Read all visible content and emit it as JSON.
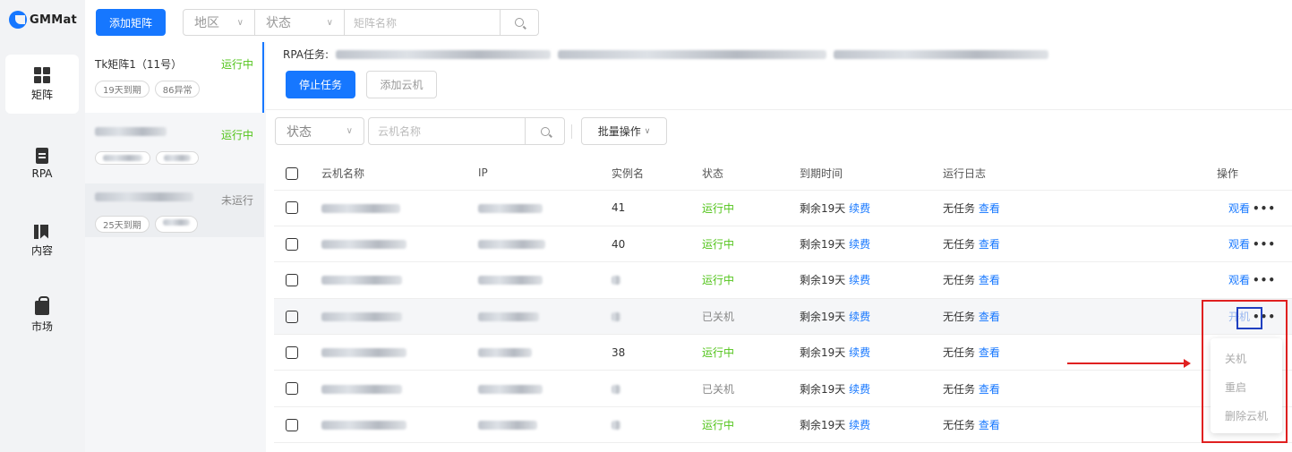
{
  "brand": "GMMat",
  "nav": [
    {
      "label": "矩阵",
      "icon": "grid-icon"
    },
    {
      "label": "RPA",
      "icon": "clipboard-icon"
    },
    {
      "label": "内容",
      "icon": "book-icon"
    },
    {
      "label": "市场",
      "icon": "shopping-bag-icon"
    }
  ],
  "topbar": {
    "add_matrix": "添加矩阵",
    "region": "地区",
    "status": "状态",
    "name_placeholder": "矩阵名称"
  },
  "matrices": [
    {
      "name": "Tk矩阵1（11号）",
      "status": "运行中",
      "tag1": "19天到期",
      "tag2": "86异常"
    },
    {
      "name": "",
      "status": "运行中",
      "tag1": "",
      "tag2": ""
    },
    {
      "name": "",
      "status": "未运行",
      "tag1": "25天到期",
      "tag2": ""
    }
  ],
  "main": {
    "rpa_label": "RPA任务:",
    "stop_task": "停止任务",
    "add_cloud": "添加云机",
    "status_filter": "状态",
    "cloud_name_placeholder": "云机名称",
    "batch_ops": "批量操作"
  },
  "table": {
    "headers": {
      "name": "云机名称",
      "ip": "IP",
      "instance": "实例名",
      "status": "状态",
      "expire": "到期时间",
      "log": "运行日志",
      "ops": "操作"
    },
    "rows": [
      {
        "instance": "41",
        "status": "运行中",
        "expire": "剩余19天",
        "renew": "续费",
        "log": "无任务",
        "view": "查看",
        "op": "观看",
        "state": "run"
      },
      {
        "instance": "40",
        "status": "运行中",
        "expire": "剩余19天",
        "renew": "续费",
        "log": "无任务",
        "view": "查看",
        "op": "观看",
        "state": "run"
      },
      {
        "instance": "",
        "status": "运行中",
        "expire": "剩余19天",
        "renew": "续费",
        "log": "无任务",
        "view": "查看",
        "op": "观看",
        "state": "run"
      },
      {
        "instance": "",
        "status": "已关机",
        "expire": "剩余19天",
        "renew": "续费",
        "log": "无任务",
        "view": "查看",
        "op": "开机",
        "state": "stop"
      },
      {
        "instance": "38",
        "status": "运行中",
        "expire": "剩余19天",
        "renew": "续费",
        "log": "无任务",
        "view": "查看",
        "op": "",
        "state": "run"
      },
      {
        "instance": "",
        "status": "已关机",
        "expire": "剩余19天",
        "renew": "续费",
        "log": "无任务",
        "view": "查看",
        "op": "",
        "state": "stop"
      },
      {
        "instance": "",
        "status": "运行中",
        "expire": "剩余19天",
        "renew": "续费",
        "log": "无任务",
        "view": "查看",
        "op": "",
        "state": "run"
      }
    ]
  },
  "dropdown": [
    "关机",
    "重启",
    "删除云机"
  ],
  "colors": {
    "primary": "#1677ff",
    "running": "#52c41a",
    "annotation_red": "#e02020",
    "annotation_blue": "#2040c0"
  }
}
